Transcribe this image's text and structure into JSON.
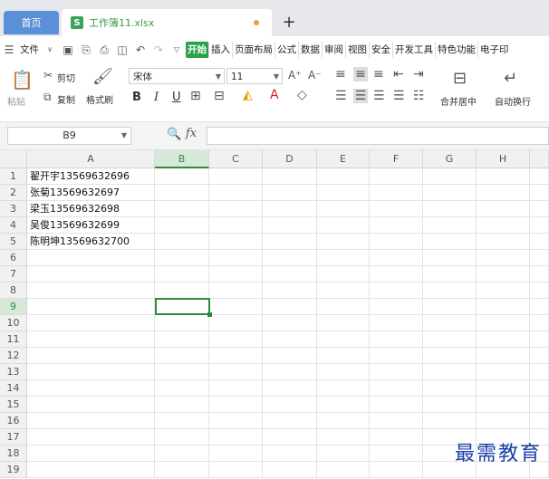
{
  "tabs": {
    "home": "首页",
    "file_name": "工作簿11.xlsx",
    "new_tab": "+"
  },
  "menu": {
    "file": "文件",
    "items": [
      "开始",
      "插入",
      "页面布局",
      "公式",
      "数据",
      "审阅",
      "视图",
      "安全",
      "开发工具",
      "特色功能",
      "电子印"
    ]
  },
  "ribbon": {
    "paste": "粘贴",
    "cut": "剪切",
    "copy": "复制",
    "format_painter": "格式刷",
    "font_name": "宋体",
    "font_size": "11",
    "bold": "B",
    "italic": "I",
    "underline": "U",
    "merge_center": "合并居中",
    "auto_wrap": "自动换行"
  },
  "formula_bar": {
    "cell_ref": "B9",
    "fx": "fx",
    "value": ""
  },
  "columns": [
    "A",
    "B",
    "C",
    "D",
    "E",
    "F",
    "G",
    "H"
  ],
  "selected_column": "B",
  "selected_row": 9,
  "rows": [
    1,
    2,
    3,
    4,
    5,
    6,
    7,
    8,
    9,
    10,
    11,
    12,
    13,
    14,
    15,
    16,
    17,
    18,
    19
  ],
  "cells_a": [
    "翟开宇13569632696",
    "张菊13569632697",
    "梁玉13569632698",
    "吴俊13569632699",
    "陈明坤13569632700"
  ],
  "watermark": "最需教育"
}
